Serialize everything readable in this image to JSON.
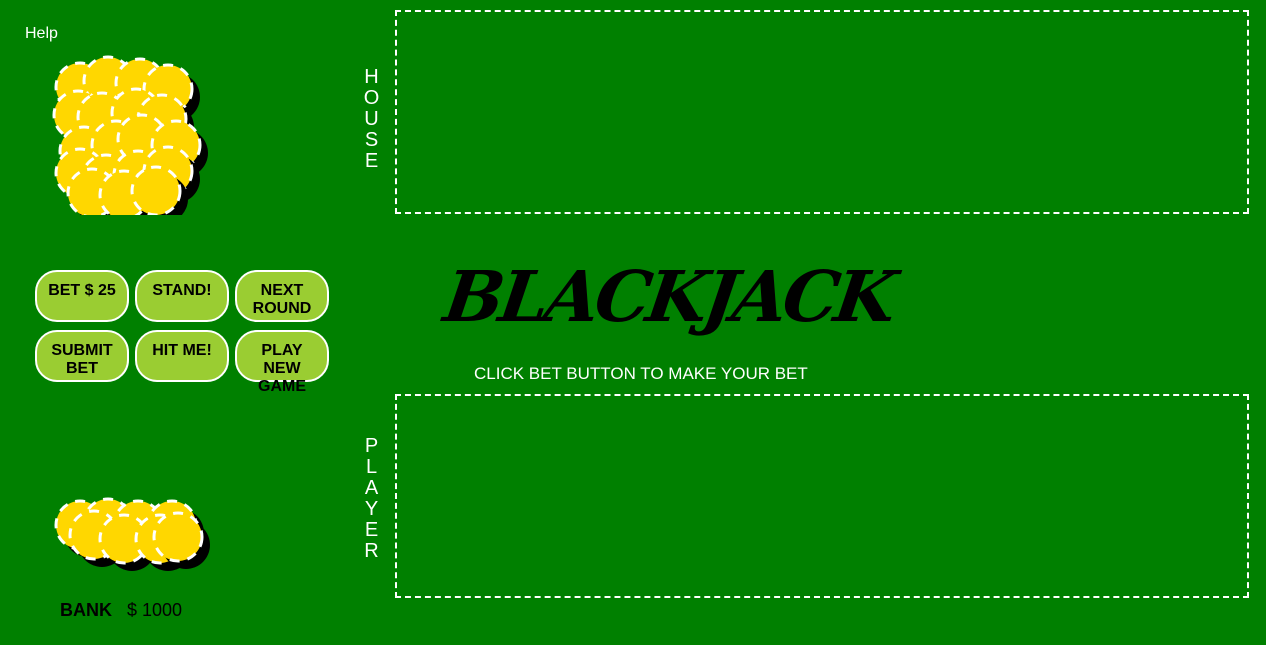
{
  "help": {
    "label": "Help"
  },
  "house": {
    "label": "HOUSE"
  },
  "player": {
    "label": "PLAYER"
  },
  "title": "BLACKJACK",
  "status_message": "CLICK BET BUTTON TO MAKE YOUR BET",
  "buttons": {
    "bet": "BET $ 25",
    "stand": "STAND!",
    "next_round": "NEXT\nROUND",
    "submit_bet": "SUBMIT\nBET",
    "hit": "HIT ME!",
    "play_new_game": "PLAY NEW\nGAME"
  },
  "bank": {
    "label": "BANK",
    "value": "$ 1000"
  },
  "colors": {
    "table_felt": "#008000",
    "button_fill": "#9acd32",
    "chip_gold": "#ffd700",
    "text_light": "#ffffff",
    "text_dark": "#000000"
  },
  "icons": {
    "house_chips": "chip-stack-icon",
    "bank_chips": "chip-stack-icon"
  }
}
